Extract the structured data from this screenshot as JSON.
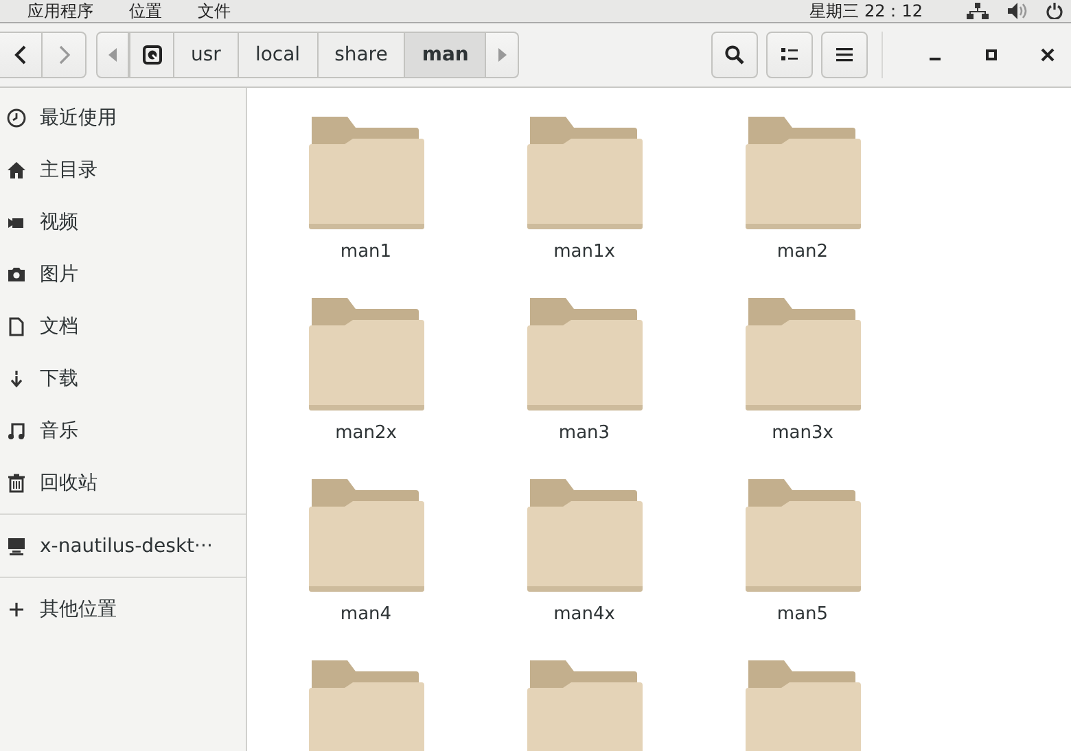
{
  "top_bar": {
    "menus": [
      "应用程序",
      "位置",
      "文件"
    ],
    "clock": "星期三 22：12"
  },
  "toolbar": {
    "path": [
      {
        "kind": "drive",
        "selected": false
      },
      {
        "kind": "dir",
        "label": "usr",
        "selected": false
      },
      {
        "kind": "dir",
        "label": "local",
        "selected": false
      },
      {
        "kind": "dir",
        "label": "share",
        "selected": false
      },
      {
        "kind": "dir",
        "label": "man",
        "selected": true
      }
    ]
  },
  "sidebar": {
    "sections": [
      [
        {
          "kind": "clock",
          "label": "最近使用"
        },
        {
          "kind": "home",
          "label": "主目录"
        },
        {
          "kind": "video",
          "label": "视频"
        },
        {
          "kind": "camera",
          "label": "图片"
        },
        {
          "kind": "document",
          "label": "文档"
        },
        {
          "kind": "download",
          "label": "下载"
        },
        {
          "kind": "music",
          "label": "音乐"
        },
        {
          "kind": "trash",
          "label": "回收站"
        }
      ],
      [
        {
          "kind": "computer",
          "label": "x-nautilus-deskt···"
        }
      ],
      [
        {
          "kind": "plus",
          "label": "其他位置"
        }
      ]
    ]
  },
  "files": [
    {
      "kind": "folder",
      "name": "man1"
    },
    {
      "kind": "folder",
      "name": "man1x"
    },
    {
      "kind": "folder",
      "name": "man2"
    },
    {
      "kind": "folder",
      "name": "man2x"
    },
    {
      "kind": "folder",
      "name": "man3"
    },
    {
      "kind": "folder",
      "name": "man3x"
    },
    {
      "kind": "folder",
      "name": "man4"
    },
    {
      "kind": "folder",
      "name": "man4x"
    },
    {
      "kind": "folder",
      "name": "man5"
    },
    {
      "kind": "folder"
    },
    {
      "kind": "folder"
    },
    {
      "kind": "folder"
    }
  ]
}
